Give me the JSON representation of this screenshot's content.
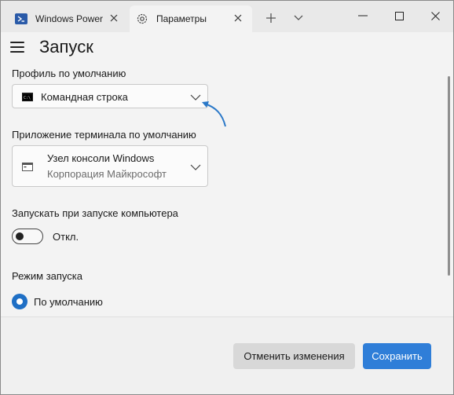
{
  "tabs": [
    {
      "label": "Windows Power",
      "icon": "powershell-icon"
    },
    {
      "label": "Параметры",
      "icon": "gear-icon"
    }
  ],
  "window_controls": {
    "minimize": "minimize-icon",
    "maximize": "maximize-icon",
    "close": "close-icon"
  },
  "page": {
    "title": "Запуск"
  },
  "default_profile": {
    "label": "Профиль по умолчанию",
    "value": "Командная строка",
    "icon": "command-prompt-icon"
  },
  "default_terminal": {
    "label": "Приложение терминала по умолчанию",
    "value": "Узел консоли Windows",
    "publisher": "Корпорация Майкрософт",
    "icon": "console-host-icon"
  },
  "launch_on_startup": {
    "label": "Запускать при запуске компьютера",
    "state_text": "Откл.",
    "on": false
  },
  "launch_mode": {
    "label": "Режим запуска",
    "selected_option": "По умолчанию"
  },
  "footer": {
    "discard_label": "Отменить изменения",
    "save_label": "Сохранить"
  },
  "colors": {
    "accent": "#2f7ed8",
    "radio_accent": "#1f6fc5",
    "annotation_arrow": "#2a78c8"
  }
}
